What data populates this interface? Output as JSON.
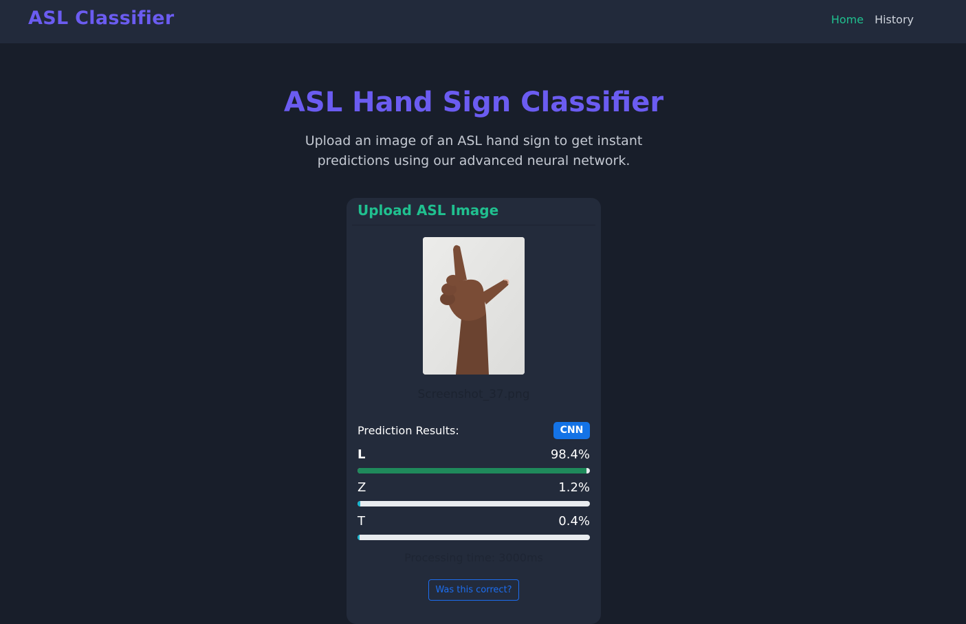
{
  "navbar": {
    "brand": "ASL Classifier",
    "links": [
      {
        "label": "Home",
        "active": true
      },
      {
        "label": "History",
        "active": false
      }
    ]
  },
  "hero": {
    "title": "ASL Hand Sign Classifier",
    "subtitle": "Upload an image of an ASL hand sign to get instant predictions using our advanced neural network."
  },
  "upload_card": {
    "title": "Upload ASL Image",
    "filename": "Screenshot_37.png",
    "results_label": "Prediction Results:",
    "model_badge": "CNN",
    "predictions": [
      {
        "letter": "L",
        "percent_label": "98.4%",
        "value": 98.4,
        "color": "#1f8a5b"
      },
      {
        "letter": "Z",
        "percent_label": "1.2%",
        "value": 1.2,
        "color": "#17b5cf"
      },
      {
        "letter": "T",
        "percent_label": "0.4%",
        "value": 0.4,
        "color": "#17b5cf"
      }
    ],
    "processing_time": "Processing time: 3000ms",
    "feedback_button": "Was this correct?"
  },
  "colors": {
    "brand": "#6b5cf1",
    "accent": "#20c08f",
    "badge": "#1473e6",
    "background": "#181e2a"
  }
}
